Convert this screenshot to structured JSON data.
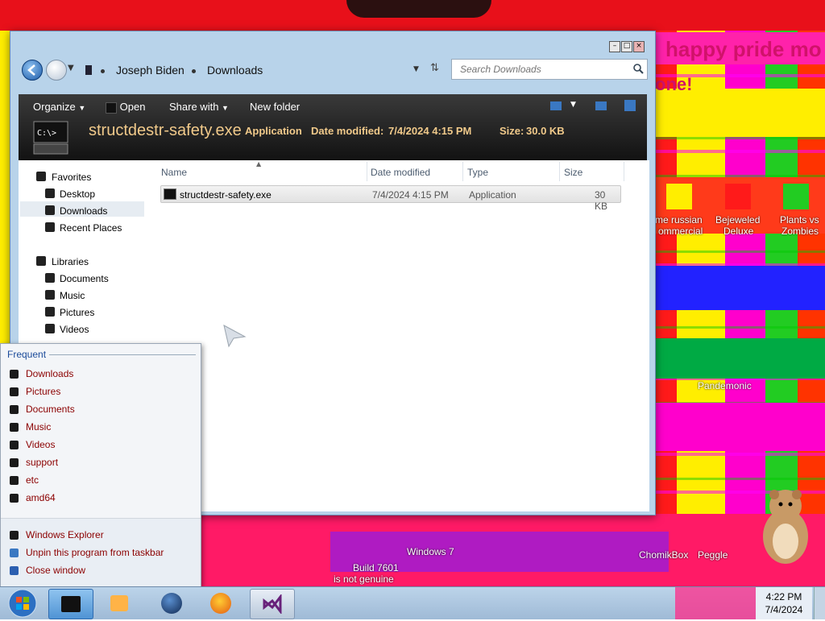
{
  "desktop": {
    "banner": "happy pride mo",
    "banner_fragment": "one!",
    "icons": [
      {
        "label": "me russian",
        "label2": "ommercial"
      },
      {
        "label": "Bejeweled",
        "label2": "Deluxe"
      },
      {
        "label": "Plants vs",
        "label2": "Zombies"
      }
    ],
    "fragments": [
      "Windows 7",
      "Build 7601",
      "is not genuine",
      "ChomikBox",
      "Peggle",
      "Pandemonic"
    ]
  },
  "window": {
    "breadcrumbs": [
      "Joseph Biden",
      "Downloads"
    ],
    "search_placeholder": "Search Downloads",
    "toolbar": {
      "organize": "Organize",
      "open": "Open",
      "share_with": "Share with",
      "new_folder": "New folder"
    },
    "details": {
      "name": "structdestr-safety.exe",
      "type": "Application",
      "date_label": "Date modified:",
      "date_value": "7/4/2024 4:15 PM",
      "size_label": "Size:",
      "size_value": "30.0 KB"
    },
    "nav": {
      "favorites": "Favorites",
      "favorites_items": [
        "Desktop",
        "Downloads",
        "Recent Places"
      ],
      "libraries": "Libraries",
      "libraries_items": [
        "Documents",
        "Music",
        "Pictures",
        "Videos"
      ]
    },
    "columns": [
      "Name",
      "Date modified",
      "Type",
      "Size"
    ],
    "files": [
      {
        "name": "structdestr-safety.exe",
        "date": "7/4/2024 4:15 PM",
        "type": "Application",
        "size": "30 KB"
      }
    ]
  },
  "jumplist": {
    "header": "Frequent",
    "items": [
      "Downloads",
      "Pictures",
      "Documents",
      "Music",
      "Videos",
      "support",
      "etc",
      "amd64"
    ],
    "actions": [
      "Windows Explorer",
      "Unpin this program from taskbar",
      "Close window"
    ]
  },
  "taskbar": {
    "time": "4:22 PM",
    "date": "7/4/2024"
  },
  "colors": {
    "accent_text": "#8b0000",
    "toolbar_bg": "#1a1a1a",
    "detail_text": "#f0c98a",
    "window_frame": "#b8d3ea"
  }
}
